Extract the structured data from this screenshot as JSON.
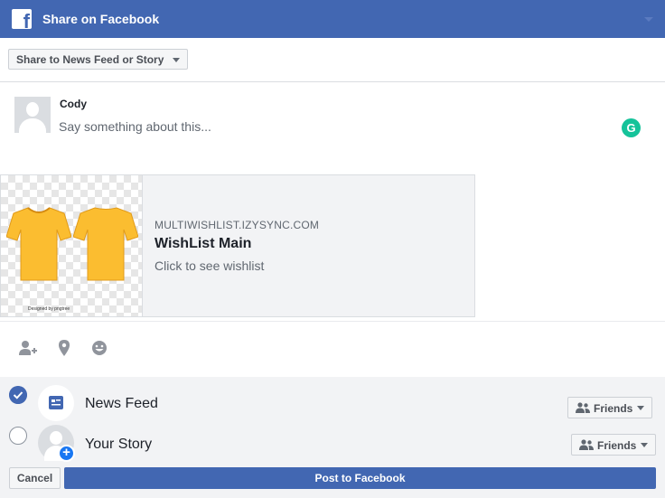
{
  "header": {
    "title": "Share on Facebook",
    "logo_letter": "f",
    "brand_color": "#4267b2"
  },
  "destination": {
    "label": "Share to News Feed or Story"
  },
  "composer": {
    "user_name": "Cody",
    "placeholder": "Say something about this...",
    "extension_icon": "grammarly-icon",
    "extension_letter": "G"
  },
  "link_preview": {
    "domain": "MULTIWISHLIST.IZYSYNC.COM",
    "title": "WishList Main",
    "description": "Click to see wishlist",
    "image_caption": "Designed by pngtree"
  },
  "tools": [
    {
      "name": "tag-friends-icon"
    },
    {
      "name": "location-icon"
    },
    {
      "name": "feeling-icon"
    }
  ],
  "audience": {
    "rows": [
      {
        "label": "News Feed",
        "checked": true,
        "privacy": "Friends"
      },
      {
        "label": "Your Story",
        "checked": false,
        "privacy": "Friends"
      }
    ]
  },
  "footer": {
    "cancel_label": "Cancel",
    "post_label": "Post to Facebook"
  }
}
